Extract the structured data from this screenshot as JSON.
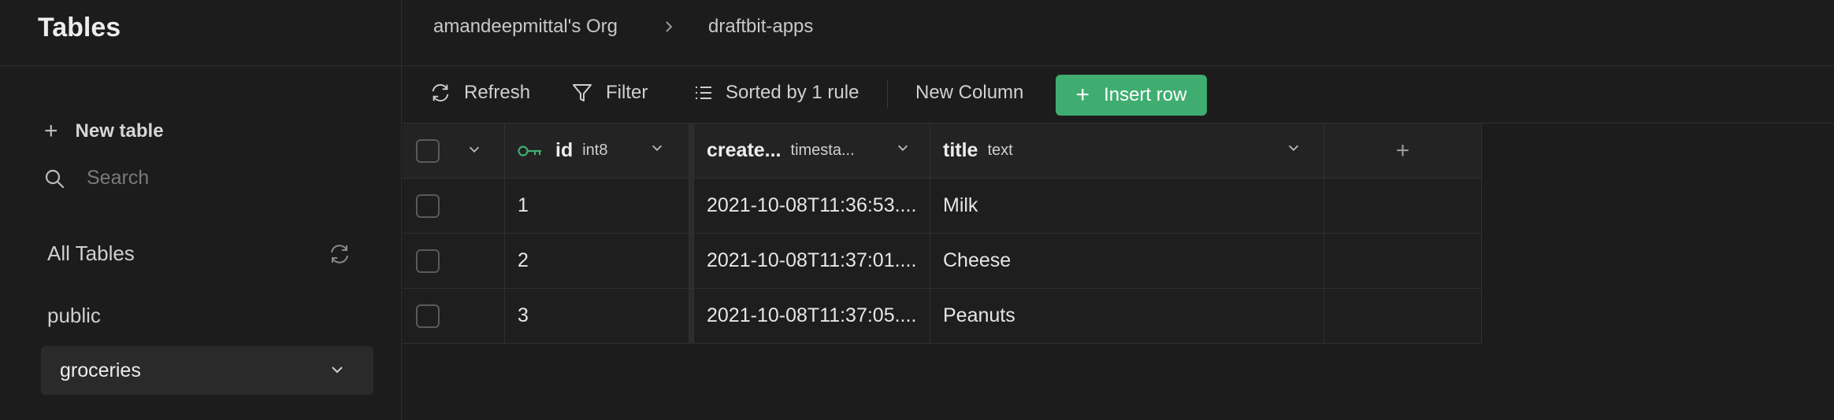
{
  "sidebar": {
    "title": "Tables",
    "new_table": "New table",
    "search_placeholder": "Search",
    "all_tables": "All Tables",
    "schema": "public",
    "selected_table": "groceries"
  },
  "breadcrumb": {
    "org": "amandeepmittal's Org",
    "project": "draftbit-apps"
  },
  "toolbar": {
    "refresh": "Refresh",
    "filter": "Filter",
    "sort": "Sorted by 1 rule",
    "new_column": "New Column",
    "insert_row": "Insert row"
  },
  "table": {
    "columns": [
      {
        "name": "id",
        "type": "int8"
      },
      {
        "name": "create...",
        "type": "timesta..."
      },
      {
        "name": "title",
        "type": "text"
      }
    ],
    "add_column": "+",
    "rows": [
      {
        "id": "1",
        "created": "2021-10-08T11:36:53....",
        "title": "Milk"
      },
      {
        "id": "2",
        "created": "2021-10-08T11:37:01....",
        "title": "Cheese"
      },
      {
        "id": "3",
        "created": "2021-10-08T11:37:05....",
        "title": "Peanuts"
      }
    ]
  },
  "colors": {
    "accent": "#3fad70",
    "background": "#1c1c1c",
    "key_icon": "#3fad70"
  }
}
